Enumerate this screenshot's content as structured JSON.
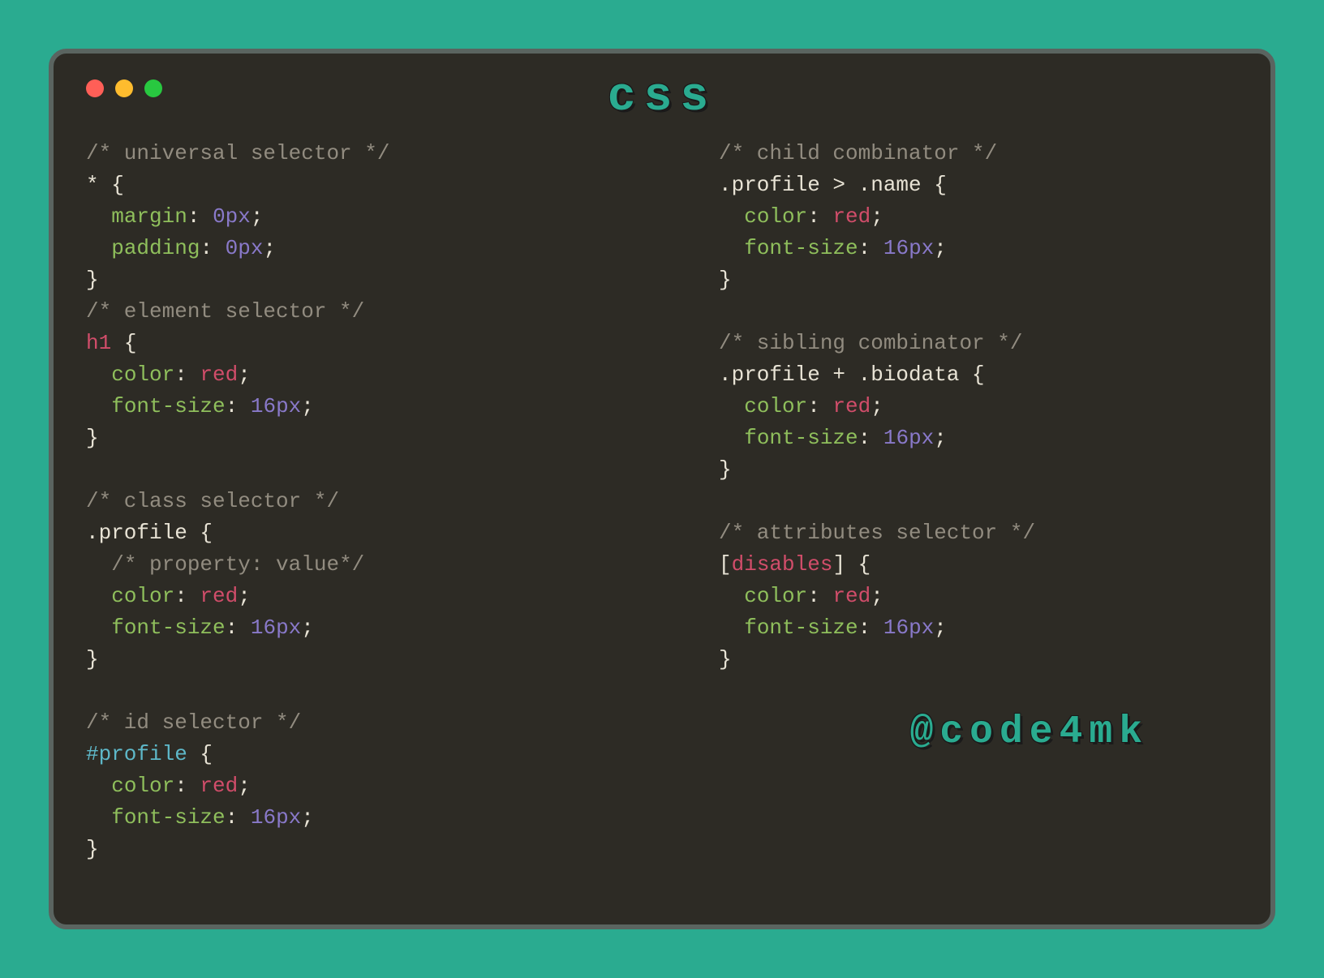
{
  "title": "css",
  "handle": "@code4mk",
  "left": {
    "block1": {
      "comment": "/* universal selector */",
      "sel1": "* ",
      "brace_open": "{",
      "line1_prop": "margin",
      "line1_val": "0px",
      "line2_prop": "padding",
      "line2_val": "0px",
      "brace_close": "}"
    },
    "block2": {
      "comment": "/* element selector */",
      "sel": "h1",
      "brace_open": " {",
      "line1_prop": "color",
      "line1_val": "red",
      "line2_prop": "font-size",
      "line2_val": "16px",
      "brace_close": "}"
    },
    "block3": {
      "comment": "/* class selector */",
      "sel": ".profile",
      "brace_open": " {",
      "inner_comment": "/* property: value*/",
      "line1_prop": "color",
      "line1_val": "red",
      "line2_prop": "font-size",
      "line2_val": "16px",
      "brace_close": "}"
    },
    "block4": {
      "comment": "/* id selector */",
      "sel": "#profile",
      "brace_open": " {",
      "line1_prop": "color",
      "line1_val": "red",
      "line2_prop": "font-size",
      "line2_val": "16px",
      "brace_close": "}"
    }
  },
  "right": {
    "block1": {
      "comment": "/* child combinator */",
      "sel": ".profile > .name",
      "brace_open": " {",
      "line1_prop": "color",
      "line1_val": "red",
      "line2_prop": "font-size",
      "line2_val": "16px",
      "brace_close": "}"
    },
    "block2": {
      "comment": "/* sibling combinator */",
      "sel": ".profile + .biodata",
      "brace_open": " {",
      "line1_prop": "color",
      "line1_val": "red",
      "line2_prop": "font-size",
      "line2_val": "16px",
      "brace_close": "}"
    },
    "block3": {
      "comment": "/* attributes selector */",
      "open_bracket": "[",
      "attr": "disables",
      "close_bracket": "]",
      "brace_open": " {",
      "line1_prop": "color",
      "line1_val": "red",
      "line2_prop": "font-size",
      "line2_val": "16px",
      "brace_close": "}"
    }
  }
}
